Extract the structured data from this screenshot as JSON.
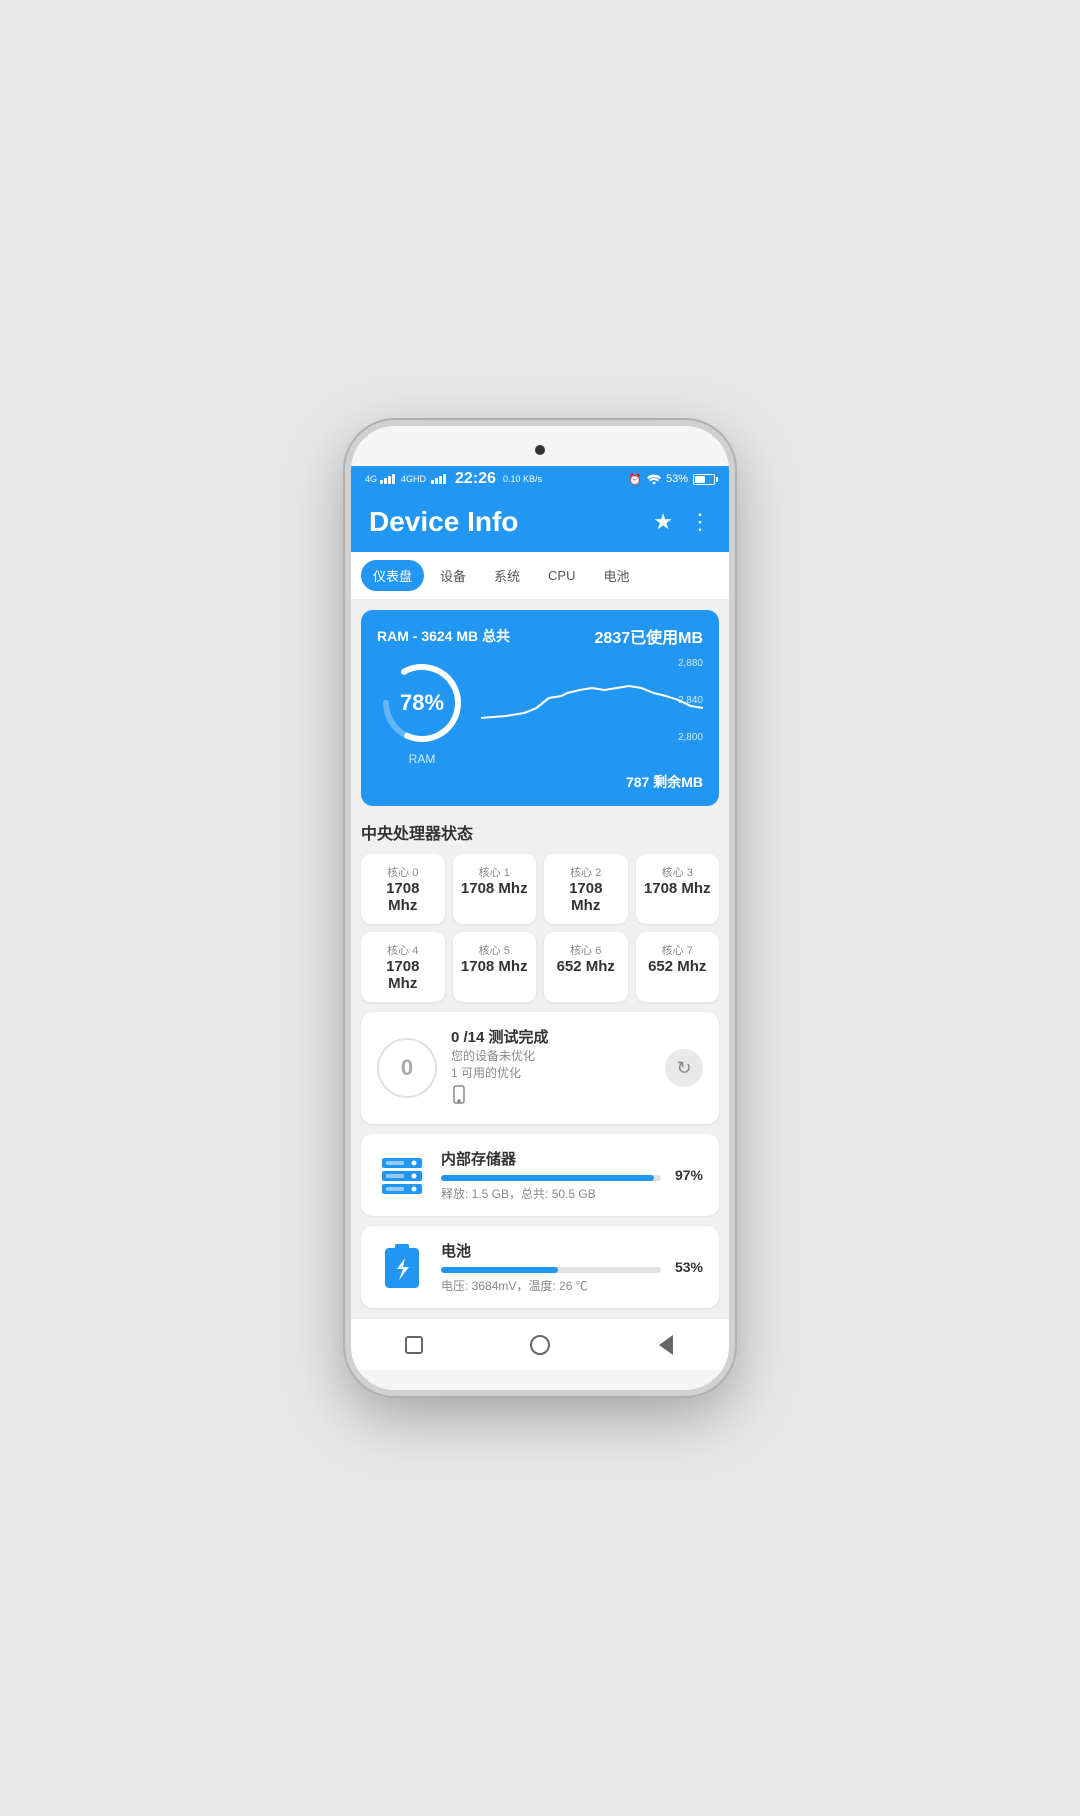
{
  "status_bar": {
    "time": "22:26",
    "network": "0.10 KB/s",
    "network_type1": "4G",
    "network_type2": "4GHD",
    "battery_pct": "53%",
    "alarm": "⏰",
    "wifi": "WiFi"
  },
  "header": {
    "title": "Device Info",
    "star_icon": "★",
    "more_icon": "⋮"
  },
  "tabs": [
    {
      "label": "仪表盘",
      "active": true
    },
    {
      "label": "设备",
      "active": false
    },
    {
      "label": "系统",
      "active": false
    },
    {
      "label": "CPU",
      "active": false
    },
    {
      "label": "电池",
      "active": false
    }
  ],
  "ram": {
    "title": "RAM - 3624 MB 总共",
    "used_label": "2837已使用MB",
    "percent": "78",
    "percent_symbol": "%",
    "label": "RAM",
    "remaining_label": "787 剩余MB",
    "chart_y_labels": [
      "2,880",
      "2,840",
      "2,800"
    ]
  },
  "cpu_section": {
    "title": "中央处理器状态",
    "cores": [
      {
        "name": "核心 0",
        "speed": "1708",
        "unit": "Mhz"
      },
      {
        "name": "核心 1",
        "speed": "1708 Mhz",
        "unit": ""
      },
      {
        "name": "核心 2",
        "speed": "1708",
        "unit": "Mhz"
      },
      {
        "name": "核心 3",
        "speed": "1708 Mhz",
        "unit": ""
      },
      {
        "name": "核心 4",
        "speed": "1708",
        "unit": "Mhz"
      },
      {
        "name": "核心 5",
        "speed": "1708 Mhz",
        "unit": ""
      },
      {
        "name": "核心 6",
        "speed": "652 Mhz",
        "unit": ""
      },
      {
        "name": "核心 7",
        "speed": "652 Mhz",
        "unit": ""
      }
    ]
  },
  "optimization": {
    "score": "0",
    "title": "0 /14 测试完成",
    "subtitle1": "您的设备未优化",
    "subtitle2": "1 可用的优化",
    "refresh_icon": "↻"
  },
  "storage": {
    "title": "内部存储器",
    "progress_pct": 97,
    "progress_label": "97%",
    "detail": "释放: 1.5 GB，总共: 50.5 GB"
  },
  "battery": {
    "title": "电池",
    "progress_pct": 53,
    "progress_label": "53%",
    "detail": "电压: 3684mV，温度: 26 ℃"
  },
  "bottom_nav": {
    "square": "□",
    "circle": "○",
    "triangle": "◁"
  },
  "colors": {
    "blue": "#2196F3",
    "light_bg": "#f0f0f0",
    "white": "#ffffff"
  }
}
